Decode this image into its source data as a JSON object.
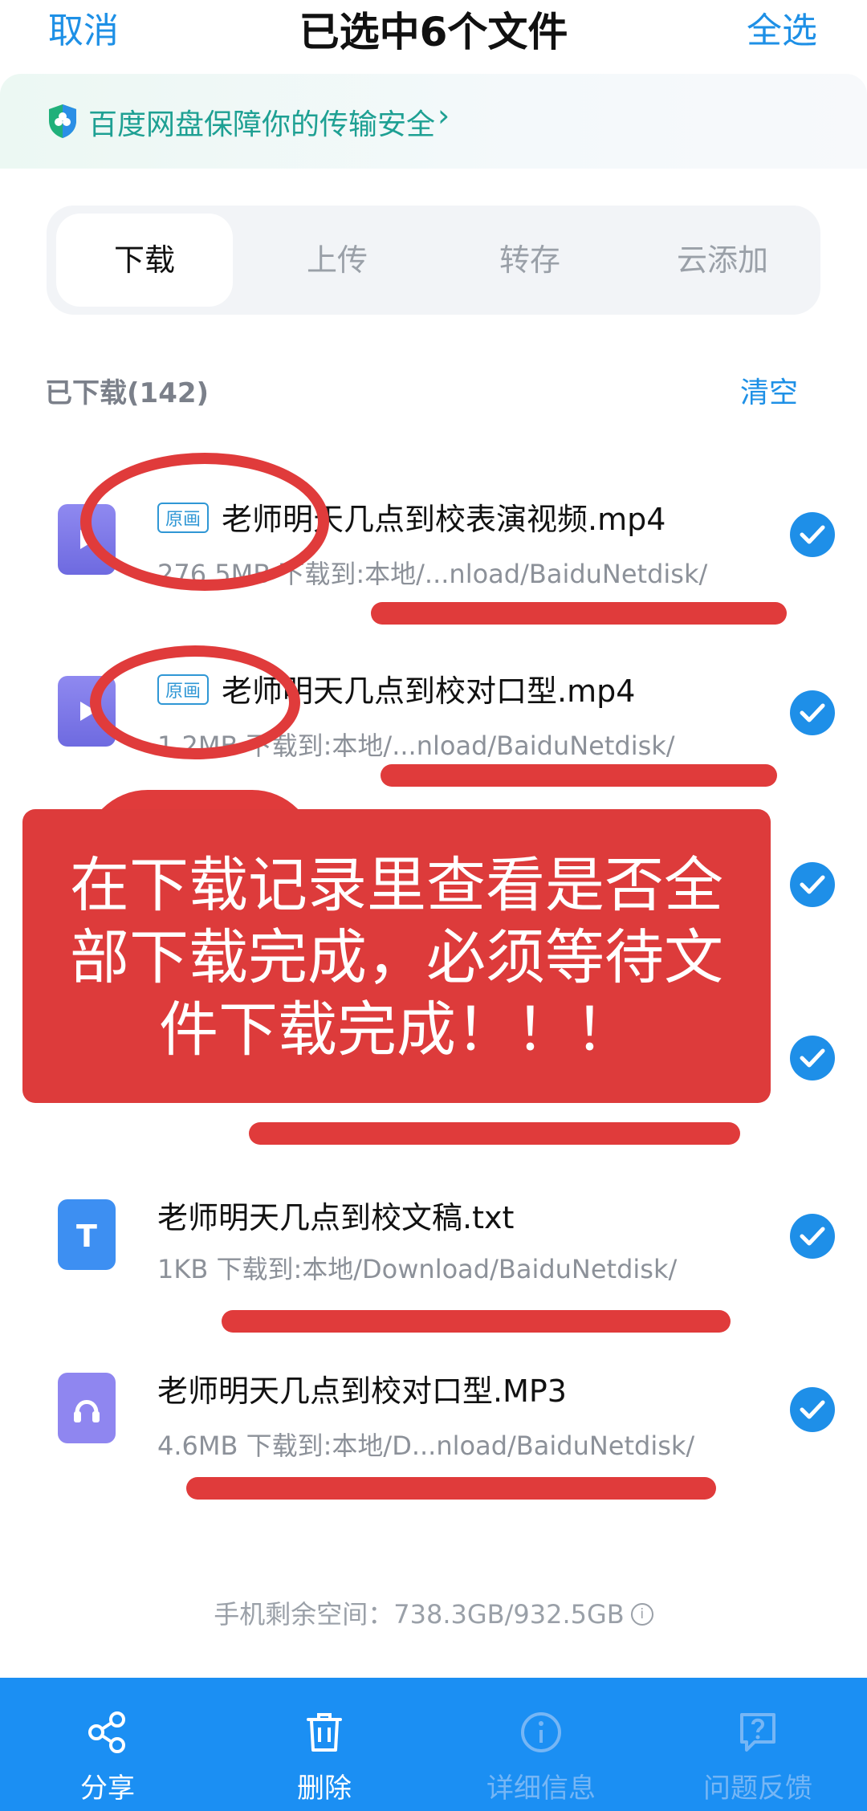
{
  "header": {
    "cancel": "取消",
    "title": "已选中6个文件",
    "select_all": "全选"
  },
  "banner": {
    "text": "百度网盘保障你的传输安全"
  },
  "tabs": [
    {
      "label": "下载",
      "active": true
    },
    {
      "label": "上传",
      "active": false
    },
    {
      "label": "转存",
      "active": false
    },
    {
      "label": "云添加",
      "active": false
    }
  ],
  "section": {
    "downloaded": "已下载(142)",
    "clear": "清空"
  },
  "files": [
    {
      "badge": "原画",
      "name": "老师明天几点到校表演视频.mp4",
      "meta": "276.5MB 下载到:本地/...nload/BaiduNetdisk/"
    },
    {
      "badge": "原画",
      "name": "老师明天几点到校对口型.mp4",
      "meta": "1.2MB 下载到:本地/...nload/BaiduNetdisk/"
    },
    {
      "name": "老师明天几点到校文稿.txt",
      "meta": "1KB 下载到:本地/Download/BaiduNetdisk/"
    },
    {
      "name": "老师明天几点到校对口型.MP3",
      "meta": "4.6MB 下载到:本地/D...nload/BaiduNetdisk/"
    }
  ],
  "overlay": {
    "line1": "在下载记录里查看是否全",
    "line2": "部下载完成，必须等待文",
    "line3": "件下载完成！！！"
  },
  "storage": {
    "text": "手机剩余空间：738.3GB/932.5GB",
    "info_icon": "i"
  },
  "bottom_bar": [
    {
      "label": "分享",
      "icon": "share-icon",
      "enabled": true
    },
    {
      "label": "删除",
      "icon": "trash-icon",
      "enabled": true
    },
    {
      "label": "详细信息",
      "icon": "info-icon",
      "enabled": false
    },
    {
      "label": "问题反馈",
      "icon": "feedback-icon",
      "enabled": false
    }
  ],
  "colors": {
    "accent": "#1e90e6",
    "annotation_red": "#e03b3b",
    "bottom_bar": "#1b8ff3",
    "banner_text": "#1ea093"
  }
}
